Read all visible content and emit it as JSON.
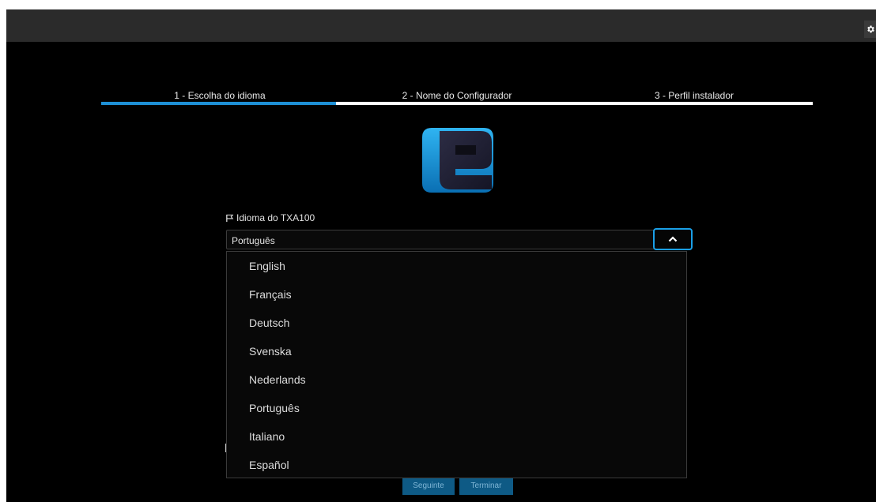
{
  "steps": [
    {
      "label": "1 - Escolha do idioma",
      "active": true
    },
    {
      "label": "2 - Nome do Configurador",
      "active": false
    },
    {
      "label": "3 - Perfil instalador",
      "active": false
    }
  ],
  "language_field": {
    "label": "Idioma do TXA100",
    "selected": "Português",
    "options": [
      "English",
      "Français",
      "Deutsch",
      "Svenska",
      "Nederlands",
      "Português",
      "Italiano",
      "Español"
    ]
  },
  "buttons": {
    "next": "Seguinte",
    "finish": "Terminar"
  },
  "icons": {
    "settings": "gear-icon",
    "field": "flag-icon",
    "toggle": "chevron-up-icon",
    "logo": "brand-logo"
  },
  "colors": {
    "accent": "#1e90d6",
    "background": "#000000",
    "topbar": "#2b2b2b",
    "button": "#0e5a85"
  }
}
